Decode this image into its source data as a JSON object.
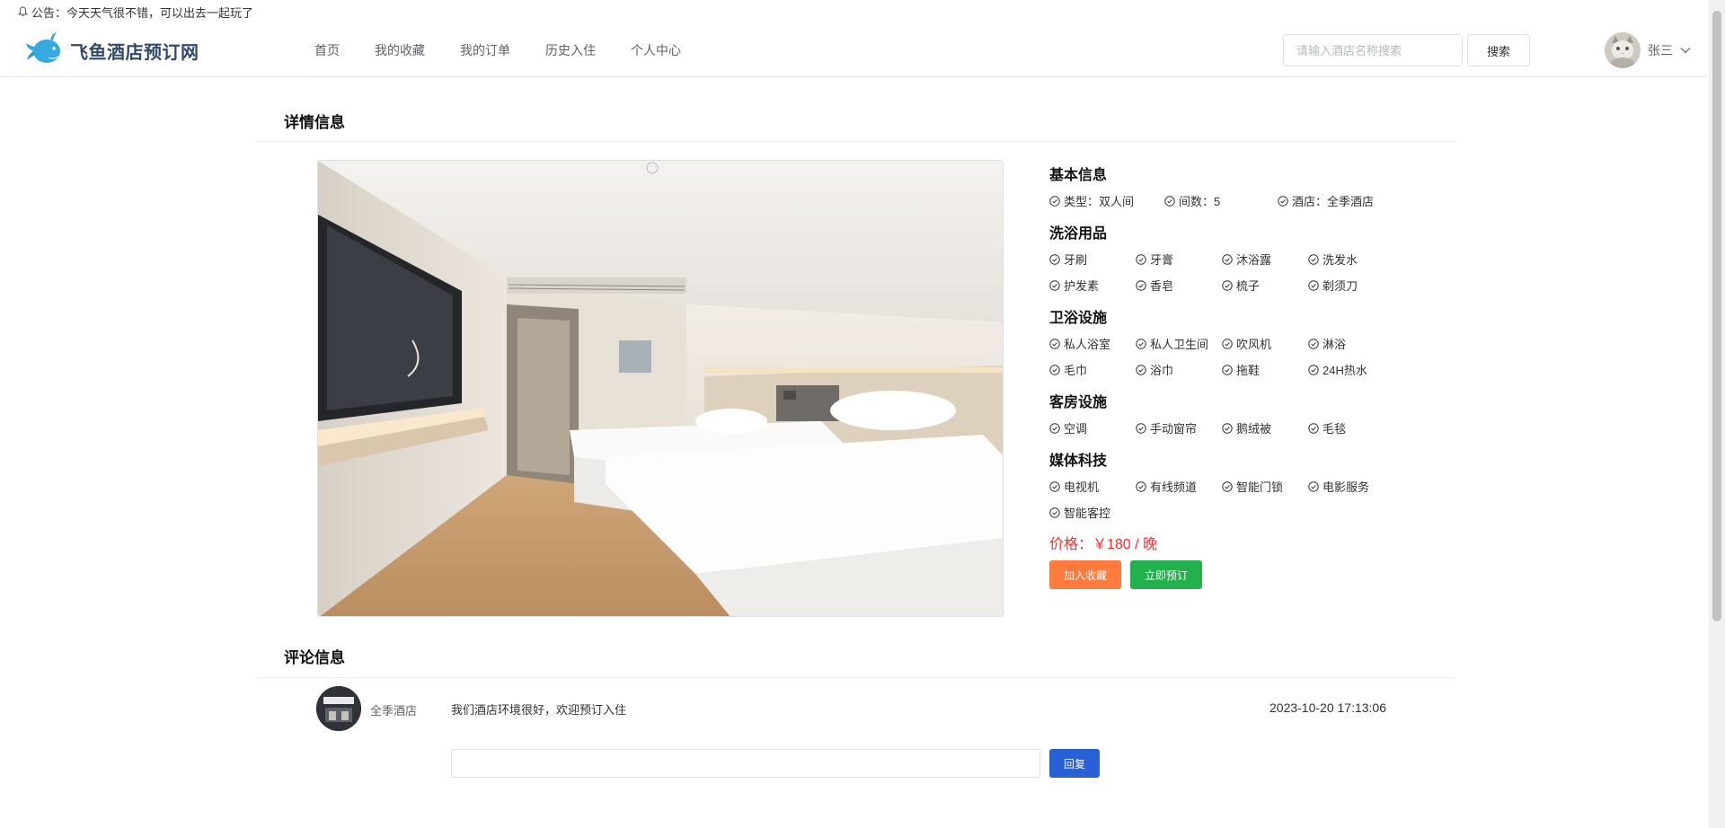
{
  "notice": {
    "icon": "bell-icon",
    "text": "公告：今天天气很不错，可以出去一起玩了"
  },
  "header": {
    "logo_text": "飞鱼酒店预订网",
    "nav": [
      {
        "label": "首页"
      },
      {
        "label": "我的收藏"
      },
      {
        "label": "我的订单"
      },
      {
        "label": "历史入住"
      },
      {
        "label": "个人中心"
      }
    ],
    "search": {
      "placeholder": "请输入酒店名称搜索",
      "value": "",
      "button_label": "搜索"
    },
    "user": {
      "name": "张三",
      "avatar": "cat-avatar",
      "dropdown_icon": "chevron-down-icon"
    }
  },
  "detail": {
    "section_title": "详情信息",
    "photo": "hotel-room-photo",
    "basic": {
      "title": "基本信息",
      "items": [
        "类型：双人间",
        "间数：5",
        "酒店：全季酒店"
      ]
    },
    "toiletries": {
      "title": "洗浴用品",
      "items": [
        "牙刷",
        "牙膏",
        "沐浴露",
        "洗发水",
        "护发素",
        "香皂",
        "梳子",
        "剃须刀"
      ]
    },
    "bathroom": {
      "title": "卫浴设施",
      "items": [
        "私人浴室",
        "私人卫生间",
        "吹风机",
        "淋浴",
        "毛巾",
        "浴巾",
        "拖鞋",
        "24H热水"
      ]
    },
    "room": {
      "title": "客房设施",
      "items": [
        "空调",
        "手动窗帘",
        "鹅绒被",
        "毛毯"
      ]
    },
    "media": {
      "title": "媒体科技",
      "items": [
        "电视机",
        "有线频道",
        "智能门锁",
        "电影服务",
        "智能客控"
      ]
    },
    "price": "价格：￥180 / 晚",
    "buttons": {
      "favorite": "加入收藏",
      "book": "立即预订"
    },
    "colors": {
      "price": "#ff2b2b",
      "favorite": "#ff7a3d",
      "book": "#22b14c",
      "reply": "#2a60d6"
    }
  },
  "comments": {
    "section_title": "评论信息",
    "items": [
      {
        "author": "全季酒店",
        "text": "我们酒店环境很好，欢迎预订入住",
        "time": "2023-10-20 17:13:06"
      }
    ],
    "reply": {
      "value": "",
      "button_label": "回复"
    }
  }
}
